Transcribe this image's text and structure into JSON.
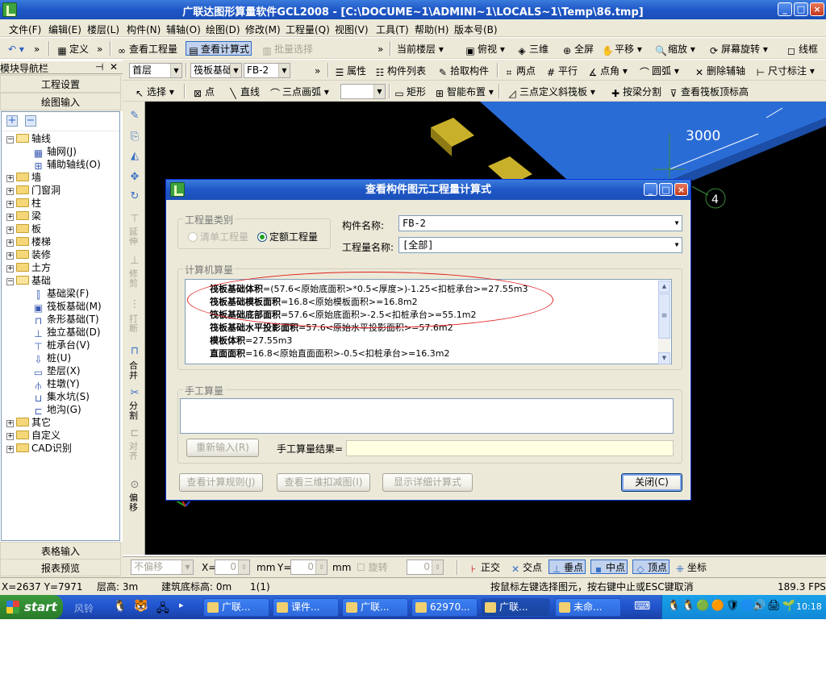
{
  "app": {
    "title": "广联达图形算量软件GCL2008 - [C:\\DOCUME~1\\ADMINI~1\\LOCALS~1\\Temp\\86.tmp]"
  },
  "menu": [
    "文件(F)",
    "编辑(E)",
    "楼层(L)",
    "构件(N)",
    "辅轴(O)",
    "绘图(D)",
    "修改(M)",
    "工程量(Q)",
    "视图(V)",
    "工具(T)",
    "帮助(H)",
    "版本号(B)"
  ],
  "toolbar1": {
    "define": "定义",
    "view_quantity": "查看工程量",
    "view_formula": "查看计算式",
    "batch_select": "批量选择",
    "current_floor": "当前楼层",
    "top_view": "俯视",
    "three_d": "三维",
    "full_screen": "全屏",
    "pan": "平移",
    "zoom": "缩放",
    "rotate_screen": "屏幕旋转",
    "wireframe": "线框"
  },
  "toolbar2": {
    "floor": "首层",
    "component_type": "筏板基础",
    "component_name": "FB-2",
    "property": "属性",
    "component_list": "构件列表",
    "pick_component": "拾取构件",
    "two_points": "两点",
    "parallel": "平行",
    "point_angle": "点角",
    "arc": "圆弧",
    "delete_axis": "删除辅轴",
    "dimension": "尺寸标注"
  },
  "toolbar3": {
    "select": "选择",
    "point": "点",
    "line": "直线",
    "three_point_arc": "三点画弧",
    "rectangle": "矩形",
    "smart_layout": "智能布置",
    "three_point_slope": "三点定义斜筏板",
    "split_by_beam": "按梁分割",
    "view_raft_elevation": "查看筏板顶标高"
  },
  "nav": {
    "header": "模块导航栏",
    "project_settings": "工程设置",
    "drawing_input": "绘图输入",
    "table_input": "表格输入",
    "report_preview": "报表预览",
    "tree": [
      {
        "label": "轴线",
        "level": 0,
        "expanded": true
      },
      {
        "label": "轴网(J)",
        "level": 1
      },
      {
        "label": "辅助轴线(O)",
        "level": 1
      },
      {
        "label": "墙",
        "level": 0
      },
      {
        "label": "门窗洞",
        "level": 0
      },
      {
        "label": "柱",
        "level": 0
      },
      {
        "label": "梁",
        "level": 0
      },
      {
        "label": "板",
        "level": 0
      },
      {
        "label": "楼梯",
        "level": 0
      },
      {
        "label": "装修",
        "level": 0
      },
      {
        "label": "土方",
        "level": 0
      },
      {
        "label": "基础",
        "level": 0,
        "expanded": true
      },
      {
        "label": "基础梁(F)",
        "level": 1
      },
      {
        "label": "筏板基础(M)",
        "level": 1
      },
      {
        "label": "条形基础(T)",
        "level": 1
      },
      {
        "label": "独立基础(D)",
        "level": 1
      },
      {
        "label": "桩承台(V)",
        "level": 1
      },
      {
        "label": "桩(U)",
        "level": 1
      },
      {
        "label": "垫层(X)",
        "level": 1
      },
      {
        "label": "柱墩(Y)",
        "level": 1
      },
      {
        "label": "集水坑(S)",
        "level": 1
      },
      {
        "label": "地沟(G)",
        "level": 1
      },
      {
        "label": "其它",
        "level": 0
      },
      {
        "label": "自定义",
        "level": 0
      },
      {
        "label": "CAD识别",
        "level": 0
      }
    ]
  },
  "vtoolbar": {
    "extend": "延伸",
    "trim": "修剪",
    "break": "打断",
    "merge": "合并",
    "split": "分割",
    "align": "对齐",
    "offset": "偏移"
  },
  "canvas": {
    "dimension_label": "3000",
    "axis_label": "4"
  },
  "statusbar": {
    "offset_mode": "不偏移",
    "x_label": "X=",
    "x_value": "0",
    "y_label": "Y=",
    "y_value": "0",
    "unit": "mm",
    "rotate": "旋转",
    "rotate_value": "0",
    "snap_ortho": "正交",
    "snap_intersection": "交点",
    "snap_perpendicular": "垂点",
    "snap_midpoint": "中点",
    "snap_vertex": "顶点",
    "snap_coordinate": "坐标",
    "coords": "X=2637 Y=7971",
    "floor_height": "层高: 3m",
    "base_elevation": "建筑底标高: 0m",
    "count": "1(1)",
    "hint": "按鼠标左键选择图元，按右键中止或ESC键取消",
    "fps": "189.3 FPS"
  },
  "taskbar": {
    "start": "start",
    "quick_label": "风铃",
    "tasks": [
      "广联...",
      "课件...",
      "广联...",
      "62970...",
      "广联...",
      "未命..."
    ],
    "clock": "10:18"
  },
  "dialog": {
    "title": "查看构件图元工程量计算式",
    "qty_type_legend": "工程量类别",
    "opt_list_qty": "清单工程量",
    "opt_quota_qty": "定额工程量",
    "component_name_label": "构件名称:",
    "component_name_value": "FB-2",
    "qty_name_label": "工程量名称:",
    "qty_name_value": "[全部]",
    "computer_calc_legend": "计算机算量",
    "formulas": [
      {
        "name": "筏板基础体积",
        "expr": "=(57.6<原始底面积>*0.5<厚度>)-1.25<扣桩承台>=27.55m3"
      },
      {
        "name": "筏板基础模板面积",
        "expr": "=16.8<原始模板面积>=16.8m2"
      },
      {
        "name": "筏板基础底部面积",
        "expr": "=57.6<原始底面积>-2.5<扣桩承台>=55.1m2"
      },
      {
        "name": "筏板基础水平投影面积",
        "expr": "=57.6<原始水平投影面积>=57.6m2"
      },
      {
        "name": "模板体积",
        "expr": "=27.55m3"
      },
      {
        "name": "直面面积",
        "expr": "=16.8<原始直面面积>-0.5<扣桩承台>=16.3m2"
      }
    ],
    "manual_calc_legend": "手工算量",
    "reenter_button": "重新输入(R)",
    "manual_result_label": "手工算量结果=",
    "view_rules_button": "查看计算规则(J)",
    "view_3d_button": "查看三维扣减图(I)",
    "show_detail_button": "显示详细计算式",
    "close_button": "关闭(C)"
  }
}
